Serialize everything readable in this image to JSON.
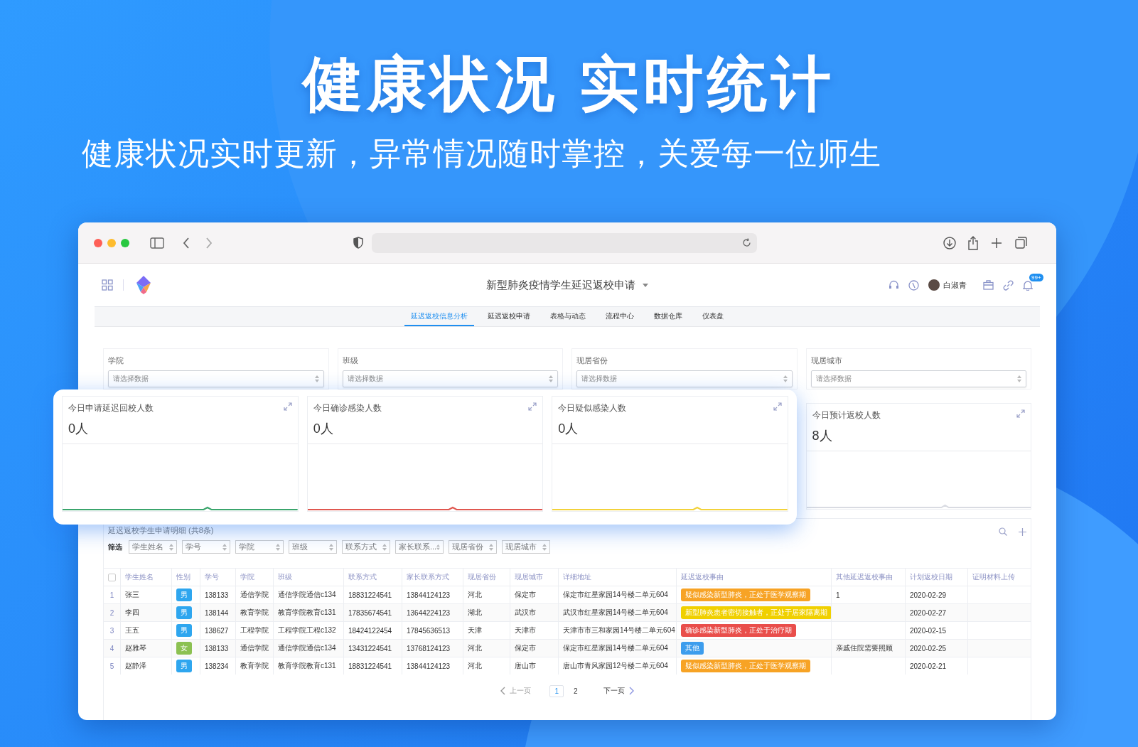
{
  "headline": "健康状况 实时统计",
  "subtitle": "健康状况实时更新，异常情况随时掌控，关爱每一位师生",
  "app": {
    "title": "新型肺炎疫情学生延迟返校申请",
    "user": "白淑青",
    "notification_badge": "99+"
  },
  "tabs": [
    {
      "label": "延迟返校信息分析",
      "selected": true
    },
    {
      "label": "延迟返校申请",
      "selected": false
    },
    {
      "label": "表格与动态",
      "selected": false
    },
    {
      "label": "流程中心",
      "selected": false
    },
    {
      "label": "数据仓库",
      "selected": false
    },
    {
      "label": "仪表盘",
      "selected": false
    }
  ],
  "filters": [
    {
      "label": "学院",
      "placeholder": "请选择数据"
    },
    {
      "label": "班级",
      "placeholder": "请选择数据"
    },
    {
      "label": "现居省份",
      "placeholder": "请选择数据"
    },
    {
      "label": "现居城市",
      "placeholder": "请选择数据"
    }
  ],
  "stats": [
    {
      "label": "今日申请延迟回校人数",
      "value": "0人",
      "color": "#3aa56c",
      "floating": true
    },
    {
      "label": "今日确诊感染人数",
      "value": "0人",
      "color": "#e0574f",
      "floating": true
    },
    {
      "label": "今日疑似感染人数",
      "value": "0人",
      "color": "#f2d23a",
      "floating": true
    },
    {
      "label": "今日预计返校人数",
      "value": "8人",
      "color": "#d9dbe2",
      "floating": false
    }
  ],
  "table": {
    "title": "延迟返校学生申请明细 (共8条)",
    "filter_label": "筛选",
    "column_filters": [
      "学生姓名",
      "学号",
      "学院",
      "班级",
      "联系方式",
      "家长联系...",
      "现居省份",
      "现居城市"
    ],
    "select_all_checked": false,
    "columns": [
      "学生姓名",
      "性别",
      "学号",
      "学院",
      "班级",
      "联系方式",
      "家长联系方式",
      "现居省份",
      "现居城市",
      "详细地址",
      "延迟返校事由",
      "其他延迟返校事由",
      "计划返校日期",
      "证明材料上传"
    ],
    "rows": [
      {
        "index": "1",
        "name": "张三",
        "gender": {
          "label": "男",
          "color": "#2ea6ef"
        },
        "student_id": "138133",
        "college": "通信学院",
        "class": "通信学院通信c134",
        "phone": "18831224541",
        "parent_phone": "13844124123",
        "province": "河北",
        "city": "保定市",
        "address": "保定市红星家园14号楼二单元604",
        "reason": {
          "label": "疑似感染新型肺炎，正处于医学观察期",
          "color": "#f7a325"
        },
        "other_reason": "1",
        "date": "2020-02-29"
      },
      {
        "index": "2",
        "name": "李四",
        "gender": {
          "label": "男",
          "color": "#2ea6ef"
        },
        "student_id": "138144",
        "college": "教育学院",
        "class": "教育学院教育c131",
        "phone": "17835674541",
        "parent_phone": "13644224123",
        "province": "湖北",
        "city": "武汉市",
        "address": "武汉市红星家园14号楼二单元604",
        "reason": {
          "label": "新型肺炎患者密切接触者，正处于居家隔离期",
          "color": "#f0d000"
        },
        "date": "2020-02-27"
      },
      {
        "index": "3",
        "name": "王五",
        "gender": {
          "label": "男",
          "color": "#2ea6ef"
        },
        "student_id": "138627",
        "college": "工程学院",
        "class": "工程学院工程c132",
        "phone": "18424122454",
        "parent_phone": "17845636513",
        "province": "天津",
        "city": "天津市",
        "address": "天津市市三和家园14号楼二单元604",
        "reason": {
          "label": "确诊感染新型肺炎，正处于治疗期",
          "color": "#e94e4b"
        },
        "date": "2020-02-15"
      },
      {
        "index": "4",
        "name": "赵雅琴",
        "gender": {
          "label": "女",
          "color": "#8cc152"
        },
        "student_id": "138133",
        "college": "通信学院",
        "class": "通信学院通信c134",
        "phone": "13431224541",
        "parent_phone": "13768124123",
        "province": "河北",
        "city": "保定市",
        "address": "保定市红星家园14号楼二单元604",
        "reason": {
          "label": "其他",
          "color": "#3d9ded"
        },
        "other_reason": "亲戚住院需要照顾",
        "date": "2020-02-25"
      },
      {
        "index": "5",
        "name": "赵静泽",
        "gender": {
          "label": "男",
          "color": "#2ea6ef"
        },
        "student_id": "138234",
        "college": "教育学院",
        "class": "教育学院教育c131",
        "phone": "18831224541",
        "parent_phone": "13844124123",
        "province": "河北",
        "city": "唐山市",
        "address": "唐山市青风家园12号楼二单元604",
        "reason": {
          "label": "疑似感染新型肺炎，正处于医学观察期",
          "color": "#f7a325"
        },
        "date": "2020-02-21"
      }
    ]
  },
  "pagination": {
    "prev": "上一页",
    "pages": [
      {
        "label": "1",
        "selected": true
      },
      {
        "label": "2",
        "selected": false
      }
    ],
    "next": "下一页"
  }
}
